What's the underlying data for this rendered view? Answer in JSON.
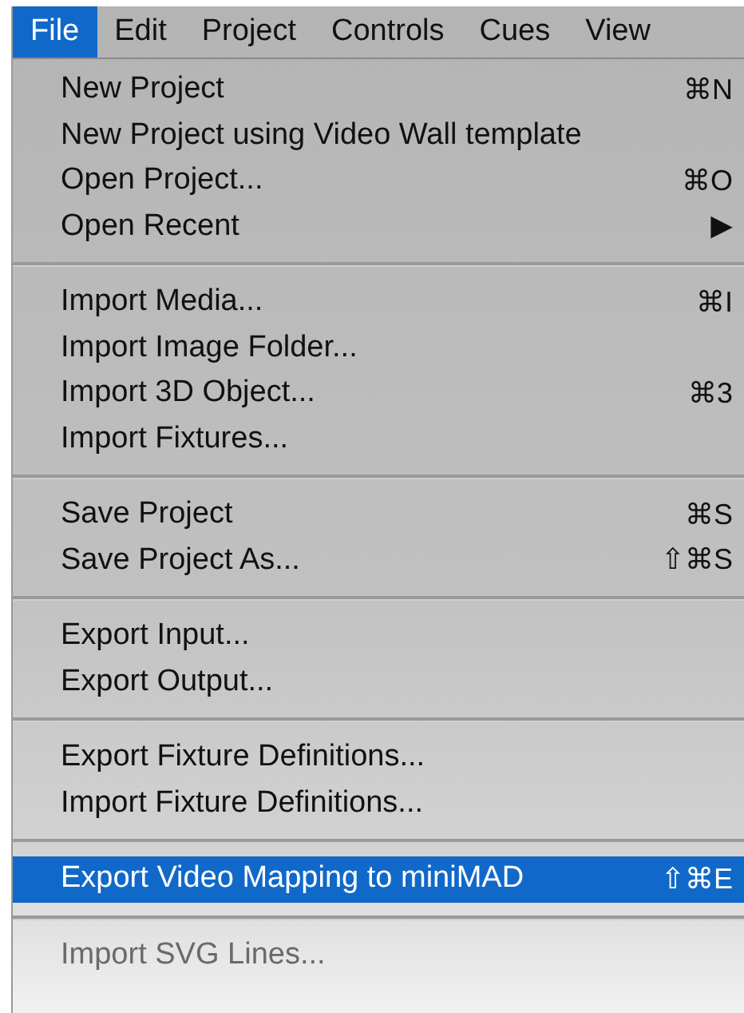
{
  "menubar": [
    {
      "label": "File",
      "selected": true
    },
    {
      "label": "Edit",
      "selected": false
    },
    {
      "label": "Project",
      "selected": false
    },
    {
      "label": "Controls",
      "selected": false
    },
    {
      "label": "Cues",
      "selected": false
    },
    {
      "label": "View",
      "selected": false
    }
  ],
  "menu": {
    "groups": [
      [
        {
          "label": "New Project",
          "shortcut": "⌘N",
          "selected": false,
          "disabled": false
        },
        {
          "label": "New Project using Video Wall template",
          "selected": false,
          "disabled": false
        },
        {
          "label": "Open Project...",
          "shortcut": "⌘O",
          "selected": false,
          "disabled": false
        },
        {
          "label": "Open Recent",
          "shortcut": "▶",
          "selected": false,
          "disabled": false
        }
      ],
      [
        {
          "label": "Import Media...",
          "shortcut": "⌘I",
          "selected": false,
          "disabled": false
        },
        {
          "label": "Import Image Folder...",
          "selected": false,
          "disabled": false
        },
        {
          "label": "Import 3D Object...",
          "shortcut": "⌘3",
          "selected": false,
          "disabled": false
        },
        {
          "label": "Import Fixtures...",
          "selected": false,
          "disabled": false
        }
      ],
      [
        {
          "label": "Save Project",
          "shortcut": "⌘S",
          "selected": false,
          "disabled": false
        },
        {
          "label": "Save Project As...",
          "shortcut": "⇧⌘S",
          "selected": false,
          "disabled": false
        }
      ],
      [
        {
          "label": "Export Input...",
          "selected": false,
          "disabled": false
        },
        {
          "label": "Export Output...",
          "selected": false,
          "disabled": false
        }
      ],
      [
        {
          "label": "Export Fixture Definitions...",
          "selected": false,
          "disabled": false
        },
        {
          "label": "Import Fixture Definitions...",
          "selected": false,
          "disabled": false
        }
      ],
      [
        {
          "label": "Export Video Mapping to miniMAD",
          "shortcut": "⇧⌘E",
          "selected": true,
          "disabled": false
        }
      ],
      [
        {
          "label": "Import SVG Lines...",
          "selected": false,
          "disabled": true
        }
      ]
    ]
  }
}
